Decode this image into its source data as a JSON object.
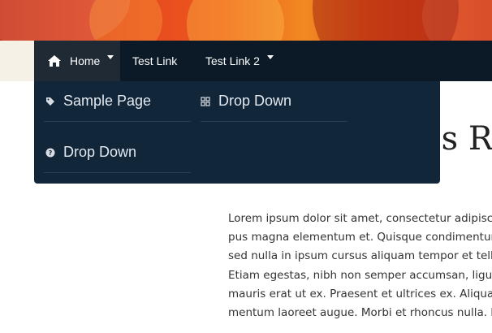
{
  "nav": {
    "items": [
      {
        "label": "Home",
        "icon": "home-icon",
        "has_dropdown": true,
        "active": true
      },
      {
        "label": "Test Link",
        "has_dropdown": false
      },
      {
        "label": "Test Link 2",
        "has_dropdown": true
      }
    ]
  },
  "dropdown": {
    "items": [
      {
        "label": "Sample Page",
        "icon": "tag-icon"
      },
      {
        "label": "Drop Down",
        "icon": "grid-icon"
      },
      {
        "label": "Drop Down",
        "icon": "question-circle-icon"
      }
    ]
  },
  "page": {
    "title_fragment": "es R",
    "body_lines": [
      "Lorem ipsum dolor sit amet, consectetur adipisci",
      "pus magna elementum et. Quisque condimentum",
      "sed nulla in ipsum cursus aliquam tempor et tellu",
      "Etiam egestas, nibh non semper accumsan, ligula",
      "mauris erat ut ex. Praesent et ultrices ex. Aliquam",
      "mentum laoreet augue. Morbi et rhoncus nulla. In"
    ]
  },
  "colors": {
    "navbar": "#0c1a27",
    "active_nav": "#1f2a35",
    "dropdown": "#12263a",
    "hero_accent": "#e2451f"
  }
}
